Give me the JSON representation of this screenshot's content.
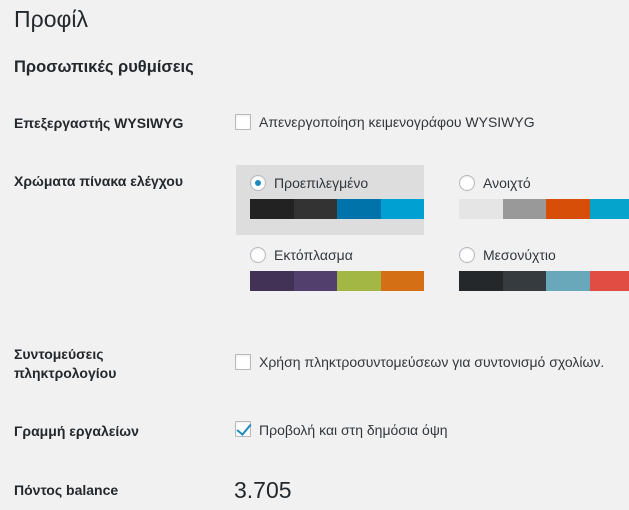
{
  "page": {
    "title": "Προφίλ"
  },
  "section": {
    "title": "Προσωπικές ρυθμίσεις"
  },
  "wysiwyg": {
    "label": "Επεξεργαστής WYSIWYG",
    "checkbox_label": "Απενεργοποίηση κειμενογράφου WYSIWYG",
    "checked": false
  },
  "color_scheme": {
    "label": "Χρώματα πίνακα ελέγχου",
    "schemes": [
      {
        "name": "Προεπιλεγμένο",
        "selected": true,
        "colors": [
          "#222222",
          "#333333",
          "#0073aa",
          "#00a0d2"
        ]
      },
      {
        "name": "Ανοιχτό",
        "selected": false,
        "colors": [
          "#e5e5e5",
          "#999999",
          "#d64e07",
          "#04a4cc"
        ]
      },
      {
        "name": "Εκτόπλασμα",
        "selected": false,
        "colors": [
          "#413256",
          "#523f6d",
          "#a3b745",
          "#d46f15"
        ]
      },
      {
        "name": "Μεσονύχτιο",
        "selected": false,
        "colors": [
          "#25282b",
          "#363b3f",
          "#69a8bb",
          "#e14d43"
        ]
      }
    ]
  },
  "shortcuts": {
    "label_line1": "Συντομεύσεις",
    "label_line2": "πληκτρολογίου",
    "checkbox_label": "Χρήση πληκτροσυντομεύσεων για συντονισμό σχολίων.",
    "checked": false
  },
  "toolbar": {
    "label": "Γραμμή εργαλείων",
    "checkbox_label": "Προβολή και στη δημόσια όψη",
    "checked": true
  },
  "balance": {
    "label": "Πόντος balance",
    "value": "3.705"
  }
}
